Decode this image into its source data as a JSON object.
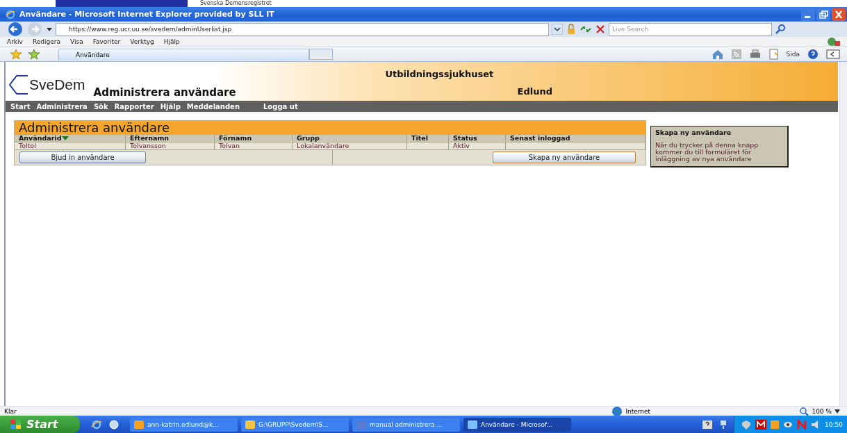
{
  "top_strip": {
    "text": "Svenska Demensregistret"
  },
  "window": {
    "title": "Användare - Microsoft Internet Explorer provided by SLL IT"
  },
  "address_bar": {
    "url": "https://www.reg.ucr.uu.se/svedem/adminUserlist.jsp",
    "search_placeholder": "Live Search"
  },
  "menu": [
    "Arkiv",
    "Redigera",
    "Visa",
    "Favoriter",
    "Verktyg",
    "Hjälp"
  ],
  "tabs": [
    {
      "label": "Användare",
      "selected": true
    }
  ],
  "command_bar": {
    "page_label": "Sida"
  },
  "page": {
    "logo": "SveDem",
    "heading": "Administrera användare",
    "org_line_1": "Utbildningssjukhuset",
    "org_line_2": "Edlund",
    "nav": [
      {
        "label": "Start"
      },
      {
        "label": "Administrera"
      },
      {
        "label": "Sök"
      },
      {
        "label": "Rapporter"
      },
      {
        "label": "Hjälp"
      },
      {
        "label": "Meddelanden"
      },
      {
        "label": "Logga ut",
        "kind": "far"
      }
    ],
    "table": {
      "title": "Administrera användare",
      "columns": [
        {
          "label": "Användarid",
          "sorted": true
        },
        {
          "label": "Efternamn",
          "sorted": false
        },
        {
          "label": "Förnamn",
          "sorted": false
        },
        {
          "label": "Grupp",
          "sorted": false
        },
        {
          "label": "Titel",
          "sorted": false
        },
        {
          "label": "Status",
          "sorted": false
        },
        {
          "label": "Senast inloggad",
          "sorted": false
        }
      ],
      "rows": [
        [
          "Toltol",
          "Tolvansson",
          "Tolvan",
          "Lokalanvändare",
          "",
          "Aktiv",
          ""
        ]
      ],
      "buttons": [
        "Bjud in användare",
        "Skapa ny användare"
      ]
    },
    "help_box": {
      "title": "Skapa ny användare",
      "text": "När du trycker på denna knapp kommer du till formuläret för inläggning av nya användare"
    }
  },
  "status_bar": {
    "text": "Klar",
    "zone": "Internet",
    "zoom": "100 %"
  },
  "taskbar": {
    "start": "Start",
    "tasks": [
      {
        "label": "ann-katrin.edlund@k...",
        "selected": false
      },
      {
        "label": "G:\\GRUPP\\Svedem\\S...",
        "selected": false
      },
      {
        "label": "manual administrera ...",
        "selected": false
      },
      {
        "label": "Användare - Microsof...",
        "selected": true
      }
    ],
    "clock": "10:50"
  }
}
